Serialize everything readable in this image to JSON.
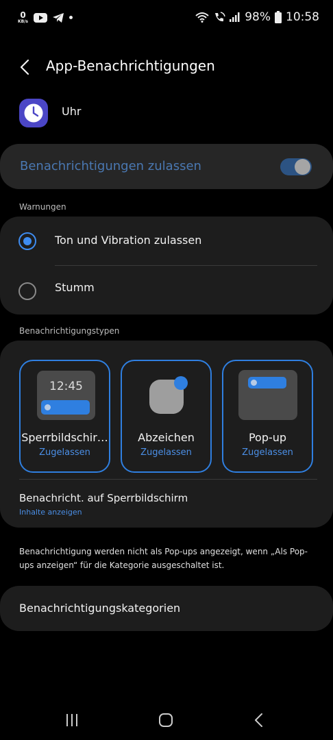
{
  "status_bar": {
    "data_rate_value": "0",
    "data_rate_unit": "KB/s",
    "battery": "98%",
    "time": "10:58"
  },
  "header": {
    "title": "App-Benachrichtigungen"
  },
  "app": {
    "name": "Uhr"
  },
  "allow_notifications": {
    "label": "Benachrichtigungen zulassen",
    "enabled": true
  },
  "warnings": {
    "section_label": "Warnungen",
    "options": [
      {
        "label": "Ton und Vibration zulassen",
        "selected": true
      },
      {
        "label": "Stumm",
        "selected": false
      }
    ]
  },
  "notification_types": {
    "section_label": "Benachrichtigungstypen",
    "tiles": [
      {
        "title": "Sperrbildschir…",
        "status": "Zugelassen",
        "preview_time": "12:45"
      },
      {
        "title": "Abzeichen",
        "status": "Zugelassen"
      },
      {
        "title": "Pop-up",
        "status": "Zugelassen"
      }
    ],
    "lockscreen": {
      "title": "Benachricht. auf Sperrbildschirm",
      "subtitle": "Inhalte anzeigen"
    }
  },
  "info_text": "Benachrichtigung werden nicht als Pop-ups angezeigt, wenn „Als Pop-ups anzeigen“ für die Kategorie ausgeschaltet ist.",
  "categories": {
    "label": "Benachrichtigungskategorien"
  },
  "colors": {
    "accent": "#2f7fe0",
    "toggle_track": "#2c5383",
    "card": "#1d1d1d",
    "background": "#000000"
  }
}
